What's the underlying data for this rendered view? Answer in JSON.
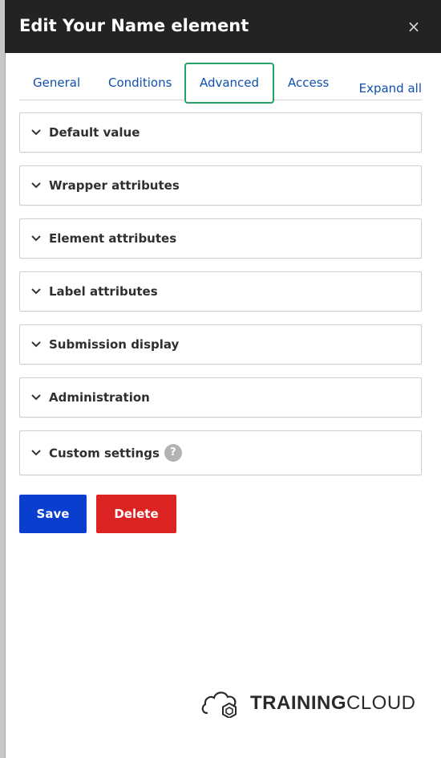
{
  "dialog": {
    "title": "Edit Your Name element",
    "close_glyph": "×"
  },
  "tabs": [
    {
      "label": "General",
      "active": false
    },
    {
      "label": "Conditions",
      "active": false
    },
    {
      "label": "Advanced",
      "active": true
    },
    {
      "label": "Access",
      "active": false
    }
  ],
  "expand_all_label": "Expand all",
  "panels": [
    {
      "label": "Default value",
      "expanded": false
    },
    {
      "label": "Wrapper attributes",
      "expanded": false
    },
    {
      "label": "Element attributes",
      "expanded": false
    },
    {
      "label": "Label attributes",
      "expanded": false
    },
    {
      "label": "Submission display",
      "expanded": false
    },
    {
      "label": "Administration",
      "expanded": false
    },
    {
      "label": "Custom settings",
      "expanded": false,
      "help_glyph": "?"
    }
  ],
  "actions": {
    "save_label": "Save",
    "delete_label": "Delete"
  },
  "logo": {
    "bold": "TRAINING",
    "light": "CLOUD"
  },
  "colors": {
    "titlebar": "#232323",
    "link": "#0f4fb0",
    "active_tab_border": "#26a269",
    "save": "#0a3ecf",
    "delete": "#dc2323"
  }
}
